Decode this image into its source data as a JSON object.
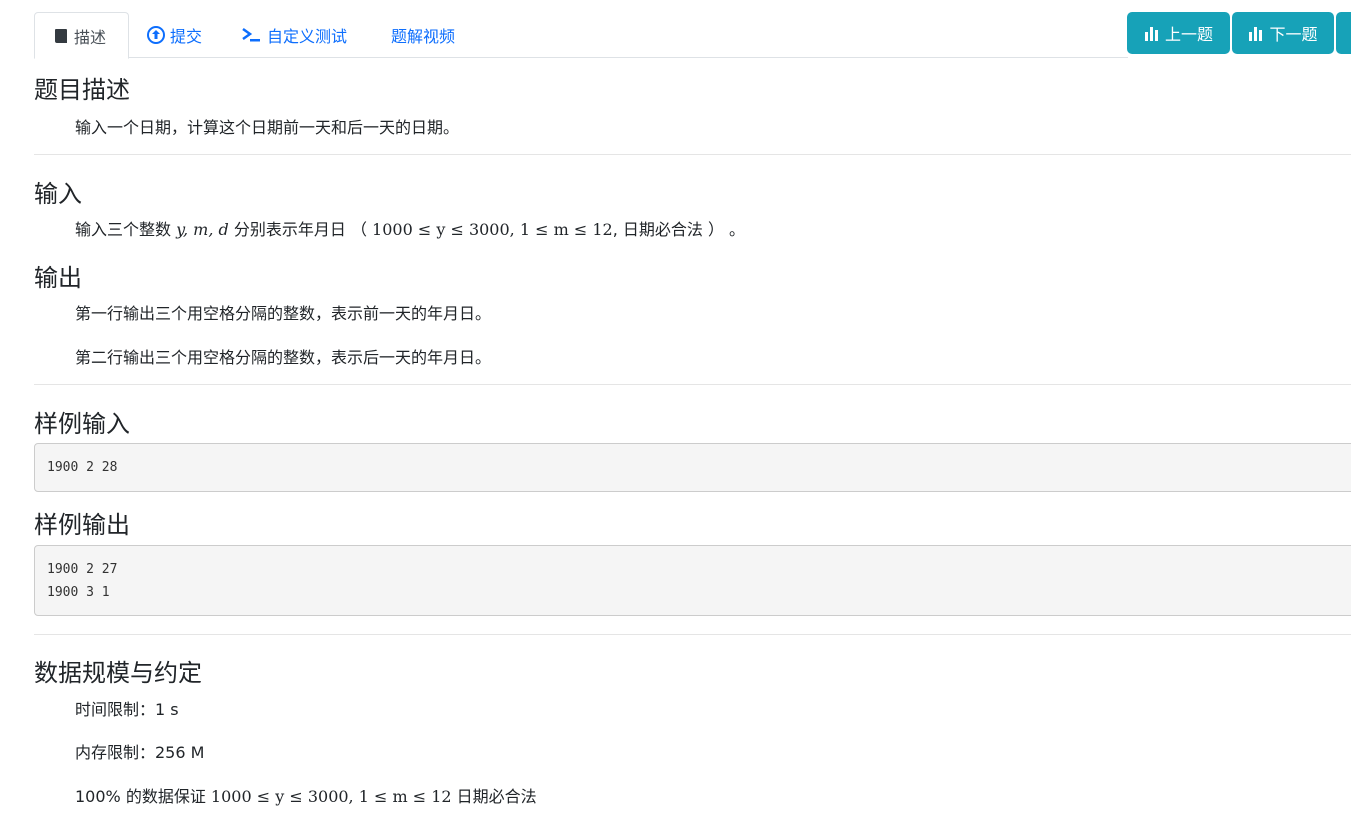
{
  "tabs": [
    {
      "label": "描述",
      "icon": "book-icon"
    },
    {
      "label": "提交",
      "icon": "upload-circle-icon"
    },
    {
      "label": "自定义测试",
      "icon": "terminal-icon"
    },
    {
      "label": "题解视频",
      "icon": ""
    }
  ],
  "nav_buttons": {
    "prev_label": "上一题",
    "next_label": "下一题",
    "icon": "bar-chart-icon",
    "accent": "#17a2b8"
  },
  "sections": {
    "description": {
      "title": "题目描述",
      "text": "输入一个日期，计算这个日期前一天和后一天的日期。"
    },
    "input": {
      "title": "输入",
      "text_before": "输入三个整数 ",
      "vars": "y, m, d",
      "text_mid": " 分别表示年月日 （ ",
      "constraint": "1000 ≤ y ≤ 3000, 1 ≤ m ≤ 12",
      "text_after": ", 日期必合法 ） 。"
    },
    "output": {
      "title": "输出",
      "line1": "第一行输出三个用空格分隔的整数，表示前一天的年月日。",
      "line2": "第二行输出三个用空格分隔的整数，表示后一天的年月日。"
    },
    "sample_input": {
      "title": "样例输入",
      "lines": [
        "1900 2 28"
      ]
    },
    "sample_output": {
      "title": "样例输出",
      "lines": [
        "1900 2 27",
        "1900 3 1"
      ]
    },
    "limits": {
      "title": "数据规模与约定",
      "time": "时间限制：1 s",
      "memory": "内存限制：256 M",
      "guarantee_prefix": "100% 的数据保证 ",
      "guarantee_math": "1000 ≤ y ≤ 3000, 1 ≤ m ≤ 12",
      "guarantee_suffix": " 日期必合法"
    }
  }
}
